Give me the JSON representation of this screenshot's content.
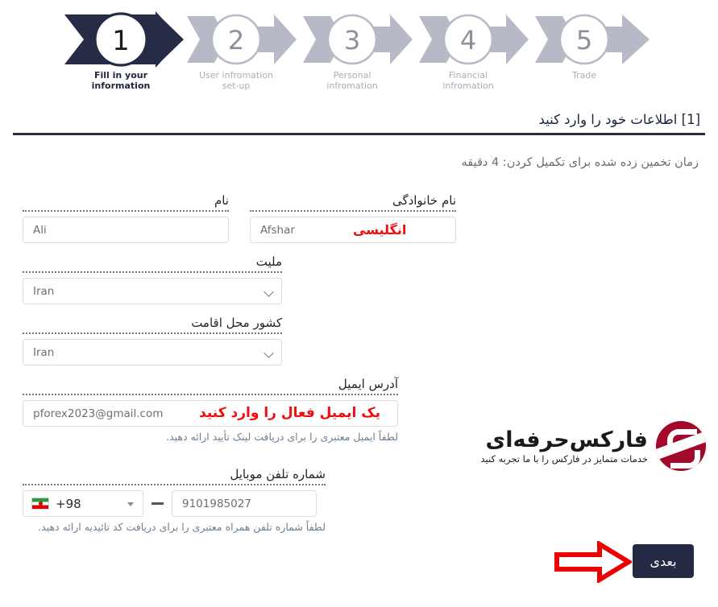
{
  "stepper": {
    "steps": [
      {
        "number": "1",
        "caption": "Fill in your\ninformation",
        "active": true
      },
      {
        "number": "2",
        "caption": "User infromation\nset-up",
        "active": false
      },
      {
        "number": "3",
        "caption": "Personal\ninfromation",
        "active": false
      },
      {
        "number": "4",
        "caption": "Financial\ninfromation",
        "active": false
      },
      {
        "number": "5",
        "caption": "Trade",
        "active": false
      }
    ],
    "active_color": "#262c45",
    "inactive_color": "#b0b3c0"
  },
  "header": {
    "section_title": "[1] اطلاعات خود را وارد کنید",
    "estimated_time": "زمان تخمین زده شده برای تکمیل کردن: 4 دقیقه"
  },
  "form": {
    "first_name": {
      "label": "نام",
      "value": "Ali"
    },
    "last_name": {
      "label": "نام خانوادگی",
      "value": "Afshar",
      "annotation": "انگلیسی"
    },
    "nationality": {
      "label": "ملیت",
      "value": "Iran"
    },
    "residence_country": {
      "label": "کشور محل اقامت",
      "value": "Iran"
    },
    "email": {
      "label": "آدرس ایمیل",
      "value": "pforex2023@gmail.com",
      "annotation": "یک ایمیل فعال را وارد کنید",
      "helper": "لطفاً ایمیل معتبری را برای دریافت لینک تأیید ارائه دهید."
    },
    "mobile": {
      "label": "شماره تلفن موبایل",
      "country_code": "+98",
      "flag": "iran-flag-icon",
      "number": "9101985027",
      "helper": "لطفاً شماره تلفن همراه معتبری را برای دریافت کد تائیدیه ارائه دهید."
    }
  },
  "logo": {
    "title": "فارکس‌حرفه‌ای",
    "subtitle": "خدمات متمایز در فارکس را با ما تجربه کنید",
    "mark_color": "#a3092b"
  },
  "footer": {
    "next_label": "بعدی",
    "arrow_color": "#ee0000",
    "button_color": "#242a44"
  }
}
